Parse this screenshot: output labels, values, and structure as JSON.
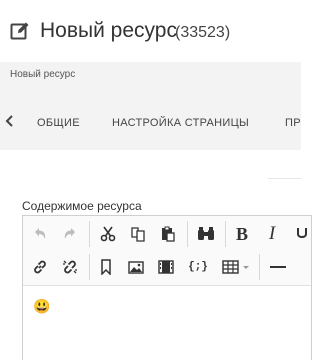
{
  "header": {
    "title": "Новый ресурс",
    "resource_id": "(33523)",
    "icon": "edit-icon"
  },
  "breadcrumb": {
    "current": "Новый ресурс"
  },
  "tabs": [
    {
      "label": "ОБЩИЕ"
    },
    {
      "label": "НАСТРОЙКА СТРАНИЦЫ"
    },
    {
      "label": "ПР"
    }
  ],
  "content_field": {
    "label": "Содержимое ресурса"
  },
  "toolbar": {
    "row1": [
      "undo-icon",
      "redo-icon",
      "cut-icon",
      "copy-icon",
      "paste-icon",
      "find-icon",
      "bold-icon",
      "italic-icon"
    ],
    "row2": [
      "link-icon",
      "unlink-icon",
      "anchor-icon",
      "image-icon",
      "media-icon",
      "code-icon",
      "table-icon",
      "horizontal-rule-icon"
    ],
    "bold_label": "B",
    "italic_label": "I",
    "code_label": "{;}"
  },
  "editor": {
    "emoji": "😃"
  },
  "colors": {
    "background": "#ffffff",
    "bar_gray": "#f3f3f3",
    "text": "#333333",
    "icon": "#444444",
    "icon_disabled": "#bdbdbd"
  }
}
